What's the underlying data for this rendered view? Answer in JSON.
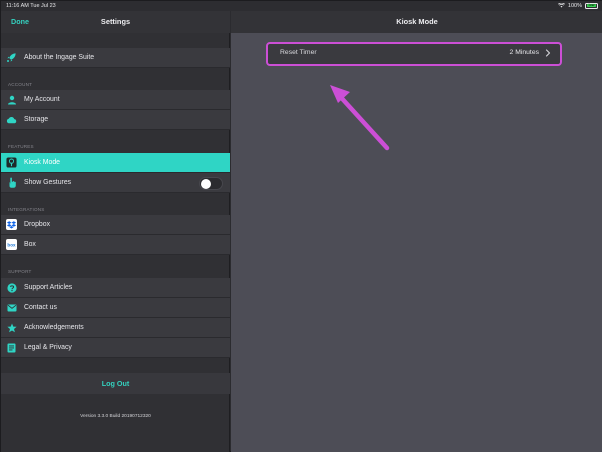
{
  "status_bar": {
    "time": "11:16 AM  Tue Jul 23",
    "battery_text": "100%",
    "battery_badge": "low"
  },
  "sidebar": {
    "done_label": "Done",
    "title": "Settings",
    "about_label": "About the Ingage Suite",
    "sections": {
      "account": "ACCOUNT",
      "features": "FEATURES",
      "integrations": "INTEGRATIONS",
      "support": "SUPPORT"
    },
    "items": {
      "my_account": "My Account",
      "storage": "Storage",
      "kiosk_mode": "Kiosk Mode",
      "show_gestures": "Show Gestures",
      "dropbox": "Dropbox",
      "box": "Box",
      "support_articles": "Support Articles",
      "contact_us": "Contact us",
      "acknowledgements": "Acknowledgements",
      "legal_privacy": "Legal & Privacy"
    },
    "show_gestures_enabled": false,
    "logout_label": "Log Out",
    "version": "Version 3.3.0 Build 20190712320"
  },
  "detail": {
    "title": "Kiosk Mode",
    "reset_timer_label": "Reset Timer",
    "reset_timer_value": "2 Minutes"
  },
  "colors": {
    "accent": "#34d1bf",
    "highlight": "#cc4fd6",
    "active_row": "#2fd5c5"
  }
}
